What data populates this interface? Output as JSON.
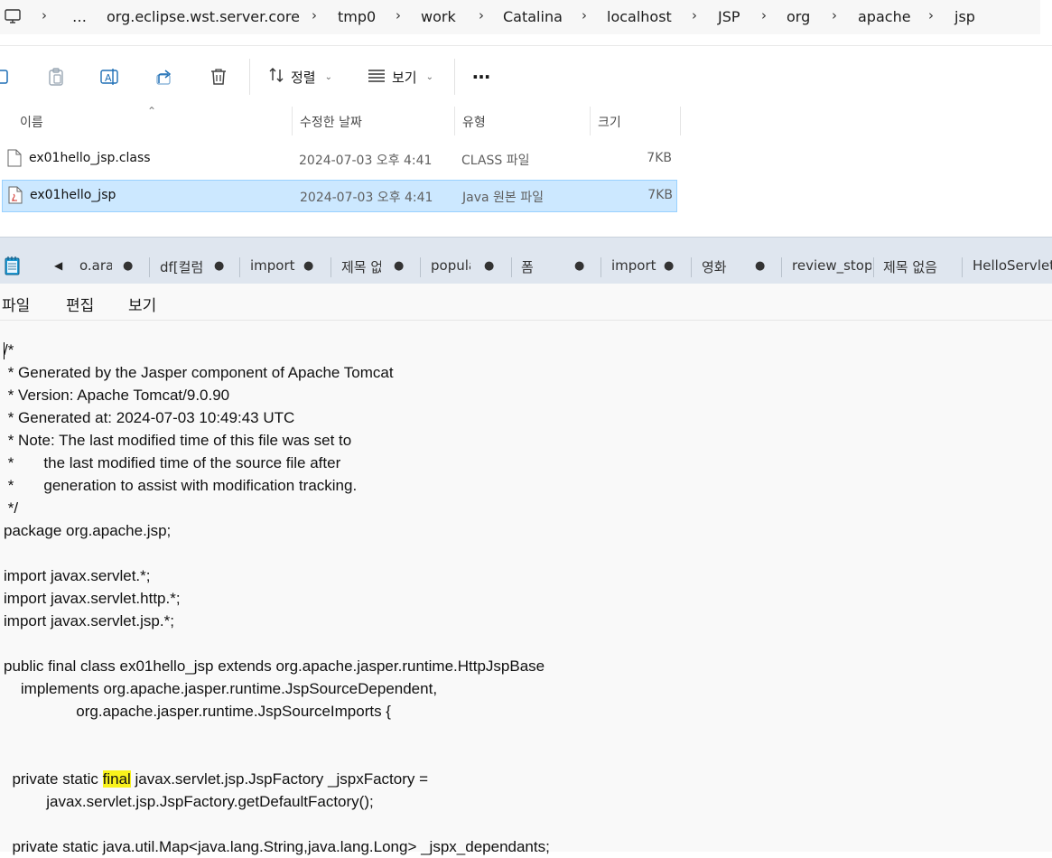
{
  "explorer": {
    "breadcrumbs": [
      "…",
      "org.eclipse.wst.server.core",
      "tmp0",
      "work",
      "Catalina",
      "localhost",
      "JSP",
      "org",
      "apache",
      "jsp"
    ],
    "toolbar": {
      "sort_label": "정렬",
      "view_label": "보기",
      "more_label": "…"
    },
    "columns": {
      "name": "이름",
      "date": "수정한 날짜",
      "type": "유형",
      "size": "크기"
    },
    "files": [
      {
        "name": "ex01hello_jsp.class",
        "date": "2024-07-03 오후 4:41",
        "type": "CLASS 파일",
        "size": "7KB",
        "icon": "blank-file-icon"
      },
      {
        "name": "ex01hello_jsp",
        "date": "2024-07-03 오후 4:41",
        "type": "Java 원본 파일",
        "size": "7KB",
        "icon": "java-file-icon"
      }
    ]
  },
  "notepad": {
    "tabs": [
      "o.arai",
      "df[컬럼",
      "import",
      "제목 없",
      "popula",
      "폼",
      "import",
      "영화",
      "review_stopv",
      "제목 없음",
      "HelloServlet."
    ],
    "menu": {
      "file": "파일",
      "edit": "편집",
      "view": "보기"
    },
    "code_lines": [
      "/*",
      " * Generated by the Jasper component of Apache Tomcat",
      " * Version: Apache Tomcat/9.0.90",
      " * Generated at: 2024-07-03 10:49:43 UTC",
      " * Note: The last modified time of this file was set to",
      " *       the last modified time of the source file after",
      " *       generation to assist with modification tracking.",
      " */",
      "package org.apache.jsp;",
      "",
      "import javax.servlet.*;",
      "import javax.servlet.http.*;",
      "import javax.servlet.jsp.*;",
      "",
      "public final class ex01hello_jsp extends org.apache.jasper.runtime.HttpJspBase",
      "    implements org.apache.jasper.runtime.JspSourceDependent,",
      "                 org.apache.jasper.runtime.JspSourceImports {",
      "",
      "",
      "  private static javax.servlet.jsp.JspFactory _jspxFactory =",
      "          javax.servlet.jsp.JspFactory.getDefaultFactory();",
      "",
      "  private static java.util.Map<java.lang.String,java.lang.Long> _jspx_dependants;"
    ],
    "highlight": {
      "before": "  private static ",
      "word": "final",
      "after": " javax.servlet.jsp.JspFactory _jspxFactory ="
    },
    "highlight_color": "#f9f21c"
  }
}
